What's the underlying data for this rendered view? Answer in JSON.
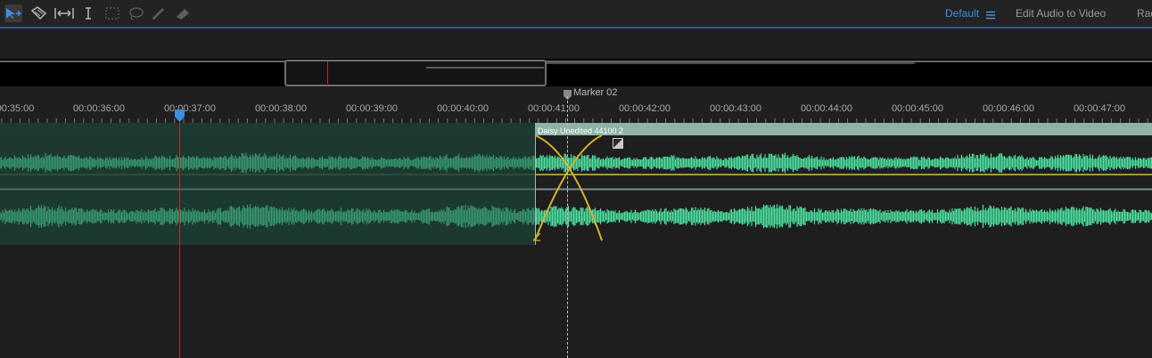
{
  "toolbar": {
    "tools": [
      {
        "name": "move-time-selection-icon"
      },
      {
        "name": "razor-icon"
      },
      {
        "name": "slip-icon"
      },
      {
        "name": "time-selection-icon"
      },
      {
        "name": "marquee-selection-icon"
      },
      {
        "name": "lasso-selection-icon"
      },
      {
        "name": "paintbrush-selection-icon"
      },
      {
        "name": "spot-healing-icon"
      }
    ],
    "workspace": {
      "default_label": "Default",
      "menu_icon": "hamburger-icon",
      "edit_audio_label": "Edit Audio to Video",
      "radio_label": "Rad"
    }
  },
  "marker": {
    "label": "Marker 02"
  },
  "ruler": {
    "ticks": [
      "00:35:00",
      "00:00:36:00",
      "00:00:37:00",
      "00:00:38:00",
      "00:00:39:00",
      "00:00:40:00",
      "00:00:41:00",
      "00:00:42:00",
      "00:00:43:00",
      "00:00:44:00",
      "00:00:45:00",
      "00:00:46:00",
      "00:00:47:00"
    ]
  },
  "clip": {
    "name": "Daisy Unedited 44100 2"
  },
  "colors": {
    "accent": "#3d8ee0",
    "playhead": "#d02020",
    "waveform_bright": "#4de0a0",
    "waveform_dim": "#4a8c74",
    "crossfade": "#d8b030"
  }
}
